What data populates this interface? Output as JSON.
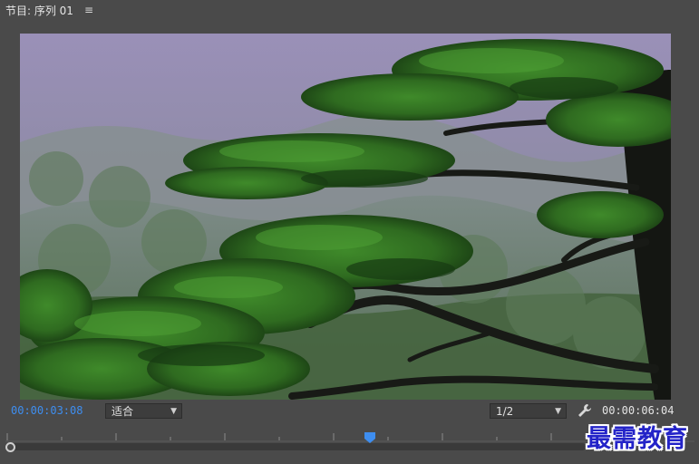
{
  "panel": {
    "title": "节目: 序列 01",
    "menu_icon": "hamburger-menu-icon",
    "menu_glyph": "≡"
  },
  "timecode": {
    "current": "00:00:03:08",
    "duration": "00:00:06:04",
    "current_color": "#3e8ef0"
  },
  "zoom_select": {
    "value": "适合",
    "icon": "chevron-down-icon"
  },
  "resolution_select": {
    "value": "1/2",
    "icon": "chevron-down-icon"
  },
  "settings": {
    "icon": "wrench-icon"
  },
  "playhead": {
    "icon": "playhead-marker-icon",
    "color": "#3e8ef0",
    "position_fraction": 0.52
  },
  "watermark": {
    "text": "最需教育"
  },
  "viewer": {
    "content": "pine-tree-on-misty-mountain-photo"
  },
  "colors": {
    "panel_bg": "#4a4a4a",
    "accent": "#3e8ef0",
    "watermark": "#2323c8"
  }
}
